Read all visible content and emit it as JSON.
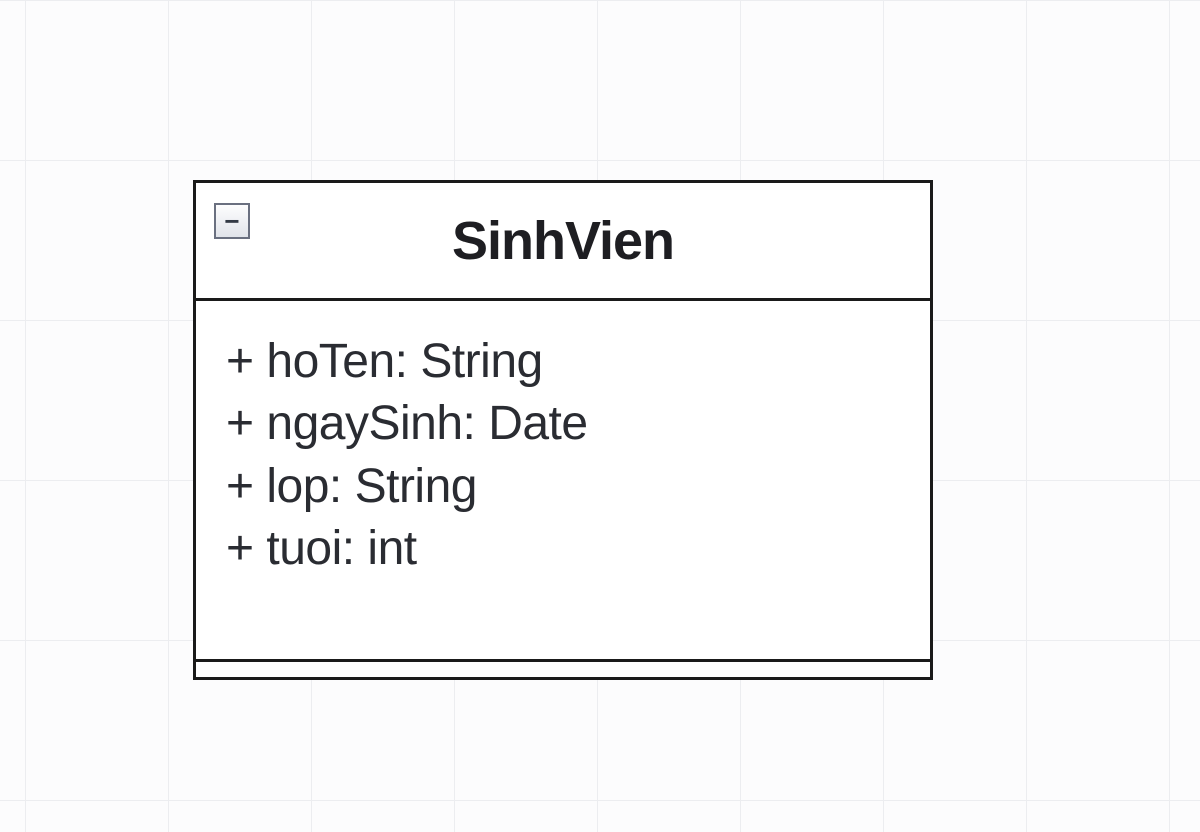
{
  "uml_class": {
    "name": "SinhVien",
    "toggle_label": "−",
    "attributes": [
      {
        "visibility": "+",
        "name": "hoTen",
        "type": "String"
      },
      {
        "visibility": "+",
        "name": "ngaySinh",
        "type": "Date"
      },
      {
        "visibility": "+",
        "name": "lop",
        "type": "String"
      },
      {
        "visibility": "+",
        "name": "tuoi",
        "type": "int"
      }
    ]
  }
}
